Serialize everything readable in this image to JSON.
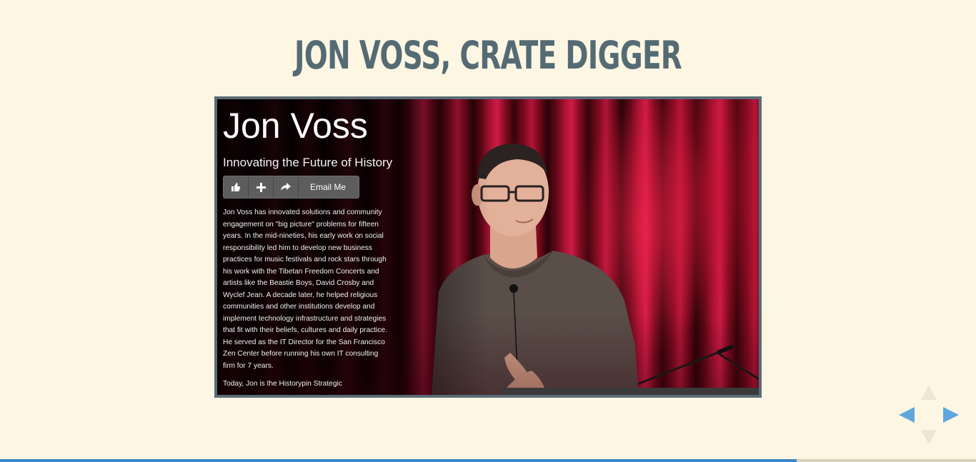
{
  "slide": {
    "title": "JON VOSS, CRATE DIGGER"
  },
  "profile": {
    "name": "Jon Voss",
    "tagline": "Innovating the Future of History",
    "buttons": {
      "like_icon": "thumbs-up-icon",
      "add_icon": "plus-icon",
      "share_icon": "share-arrow-icon",
      "email_label": "Email Me"
    },
    "bio_paragraph_1": "Jon Voss has innovated solutions and community engagement on \"big picture\" problems for fifteen years. In the mid-nineties, his early work on social responsibility led him to develop new business practices for music festivals and rock stars through his work with the Tibetan Freedom Concerts and artists like the Beastie Boys, David Crosby and Wyclef Jean. A decade later, he helped religious communities and other institutions develop and implement technology infrastructure and strategies that fit with their beliefs, cultures and daily practice. He served as the IT Director for the San Francisco Zen Center before running his own IT consulting firm for 7 years.",
    "bio_paragraph_2": "Today, Jon is the Historypin Strategic"
  },
  "navigation": {
    "up_icon": "arrow-up-icon",
    "down_icon": "arrow-down-icon",
    "left_icon": "arrow-left-icon",
    "right_icon": "arrow-right-icon"
  },
  "progress": {
    "fraction": 0.816
  },
  "colors": {
    "background": "#fdf6e3",
    "title": "#556b74",
    "frame_border": "#5a6c76",
    "accent": "#3b86c4",
    "nav_active": "#5fa8de",
    "nav_disabled": "#ece6d3"
  }
}
